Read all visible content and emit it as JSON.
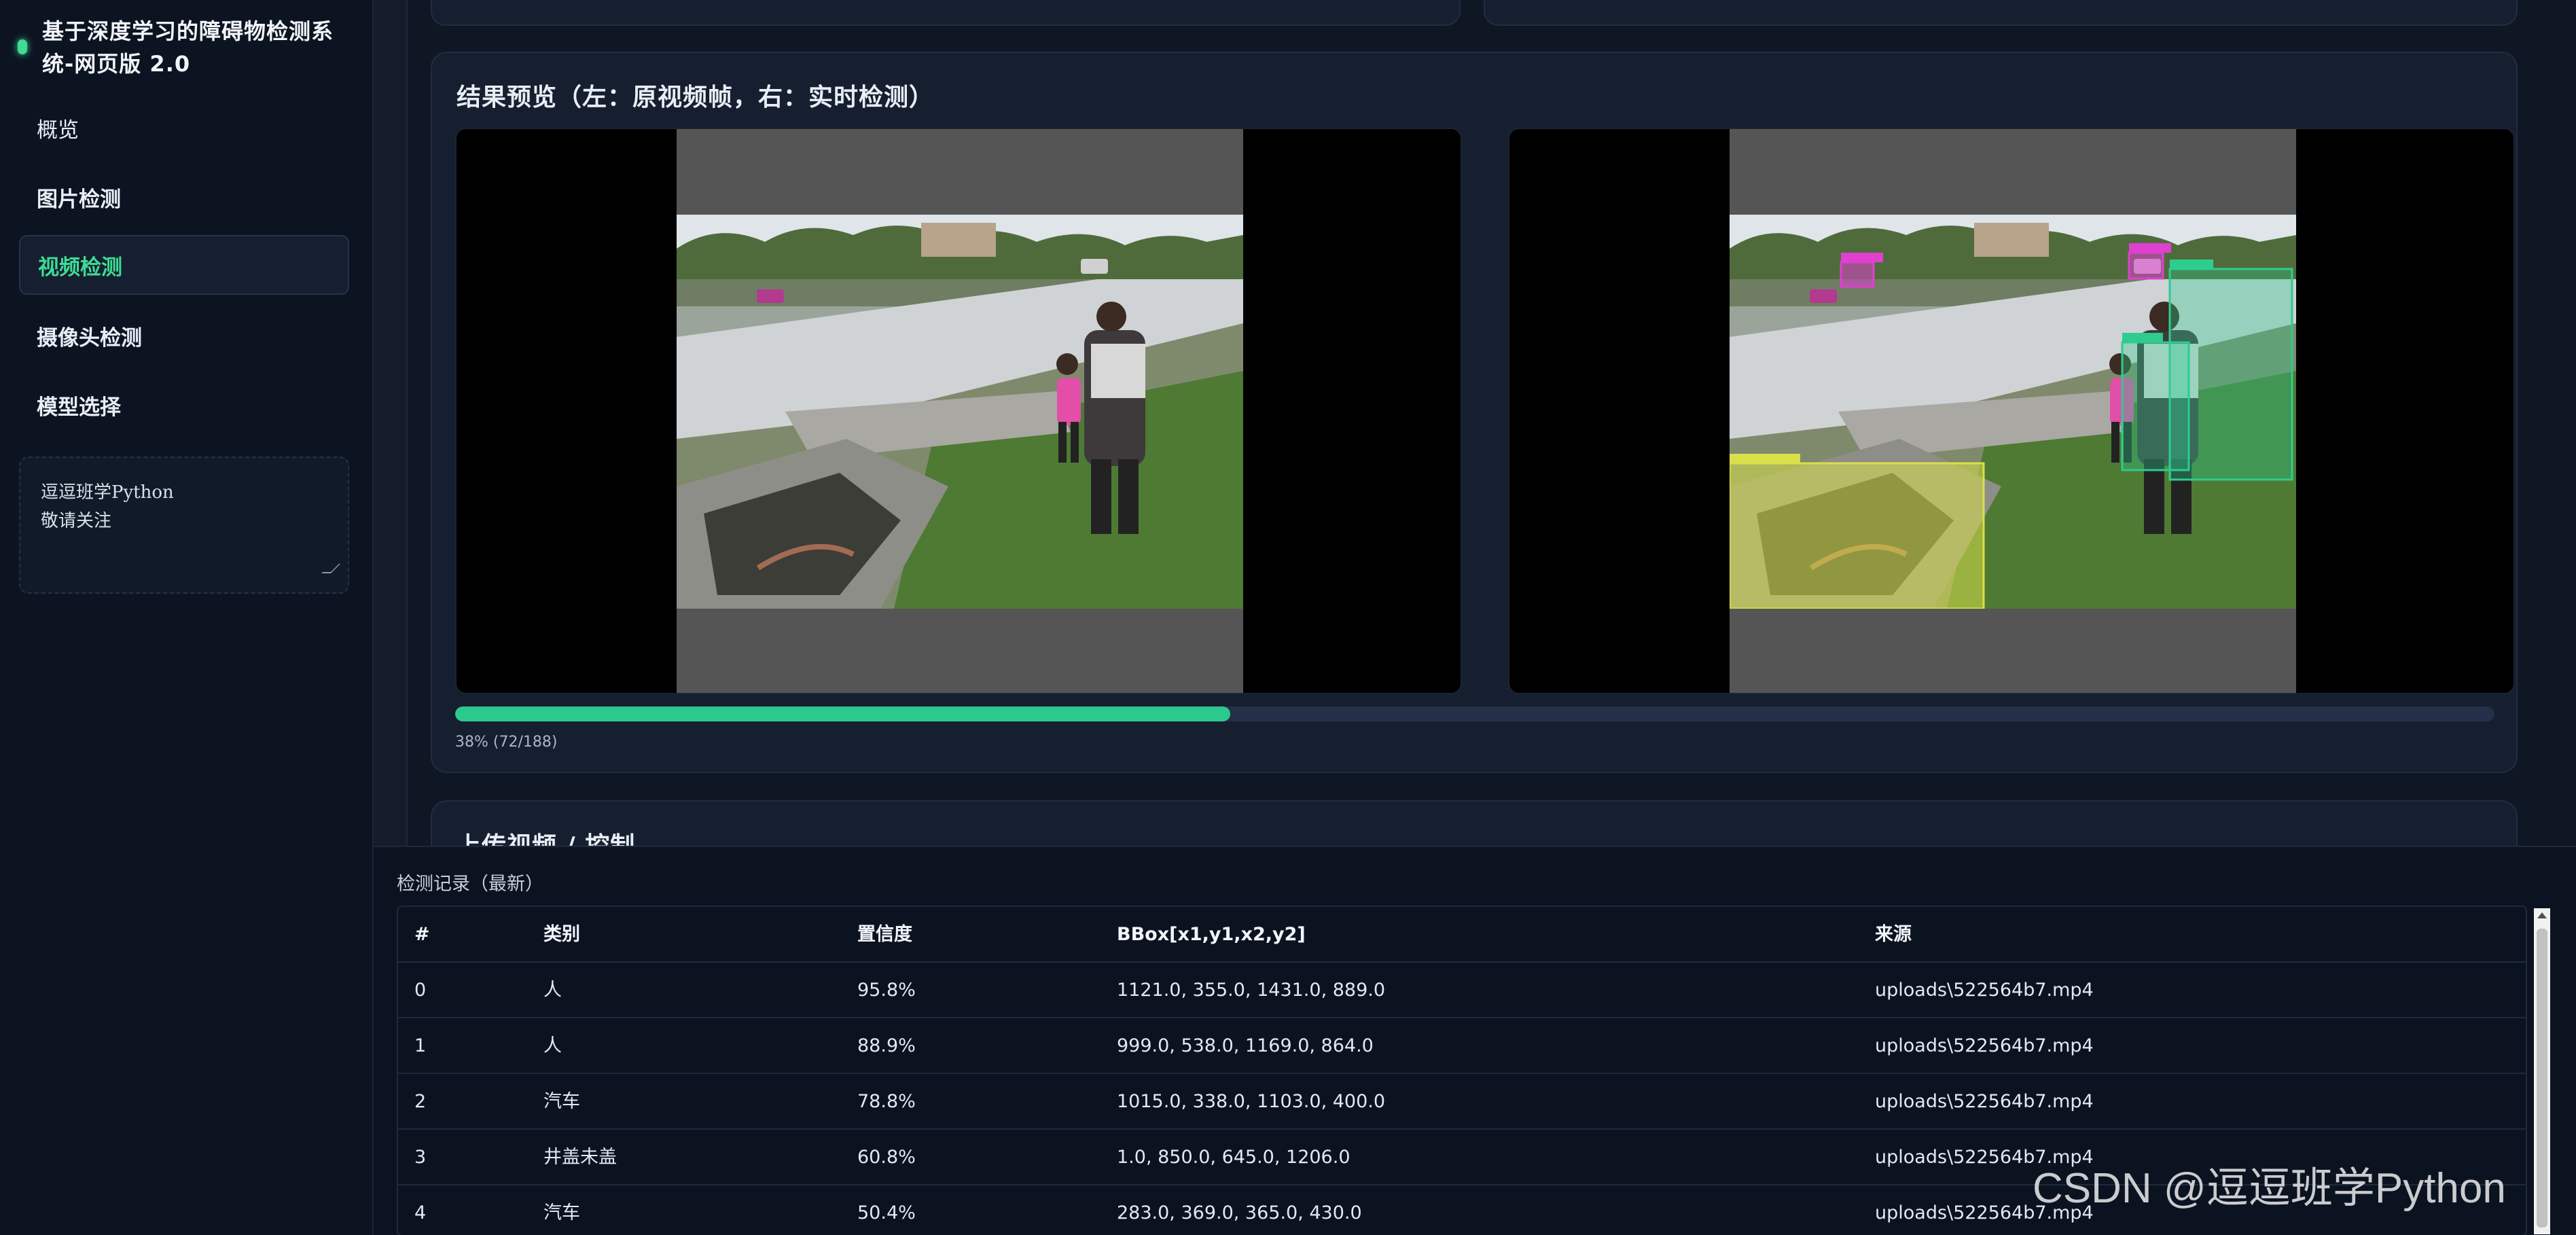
{
  "app": {
    "title": "基于深度学习的障碍物检测系统-网页版 2.0"
  },
  "sidebar": {
    "items": [
      {
        "label": "概览"
      },
      {
        "label": "图片检测"
      },
      {
        "label": "视频检测"
      },
      {
        "label": "摄像头检测"
      },
      {
        "label": "模型选择"
      }
    ],
    "active_index": 2,
    "note_text": "逗逗班学Python\n敬请关注"
  },
  "preview": {
    "title": "结果预览（左：原视频帧，右：实时检测）",
    "progress": {
      "percent": 38,
      "current": 72,
      "total": 188,
      "label": "38% (72/188)"
    }
  },
  "upload": {
    "title": "上传视频 / 控制"
  },
  "log": {
    "title": "检测记录（最新）",
    "columns": [
      "#",
      "类别",
      "置信度",
      "BBox[x1,y1,x2,y2]",
      "来源"
    ],
    "rows": [
      [
        "0",
        "人",
        "95.8%",
        "1121.0, 355.0, 1431.0, 889.0",
        "uploads\\522564b7.mp4"
      ],
      [
        "1",
        "人",
        "88.9%",
        "999.0, 538.0, 1169.0, 864.0",
        "uploads\\522564b7.mp4"
      ],
      [
        "2",
        "汽车",
        "78.8%",
        "1015.0, 338.0, 1103.0, 400.0",
        "uploads\\522564b7.mp4"
      ],
      [
        "3",
        "井盖未盖",
        "60.8%",
        "1.0, 850.0, 645.0, 1206.0",
        "uploads\\522564b7.mp4"
      ],
      [
        "4",
        "汽车",
        "50.4%",
        "283.0, 369.0, 365.0, 430.0",
        "uploads\\522564b7.mp4"
      ]
    ]
  },
  "colors": {
    "accent": "#3ddc97",
    "progress": "#2bc98d",
    "person_box": "#2ecc8f",
    "car_box": "#e040d0",
    "manhole_box": "#d9e04a"
  },
  "watermark": "CSDN @逗逗班学Python"
}
